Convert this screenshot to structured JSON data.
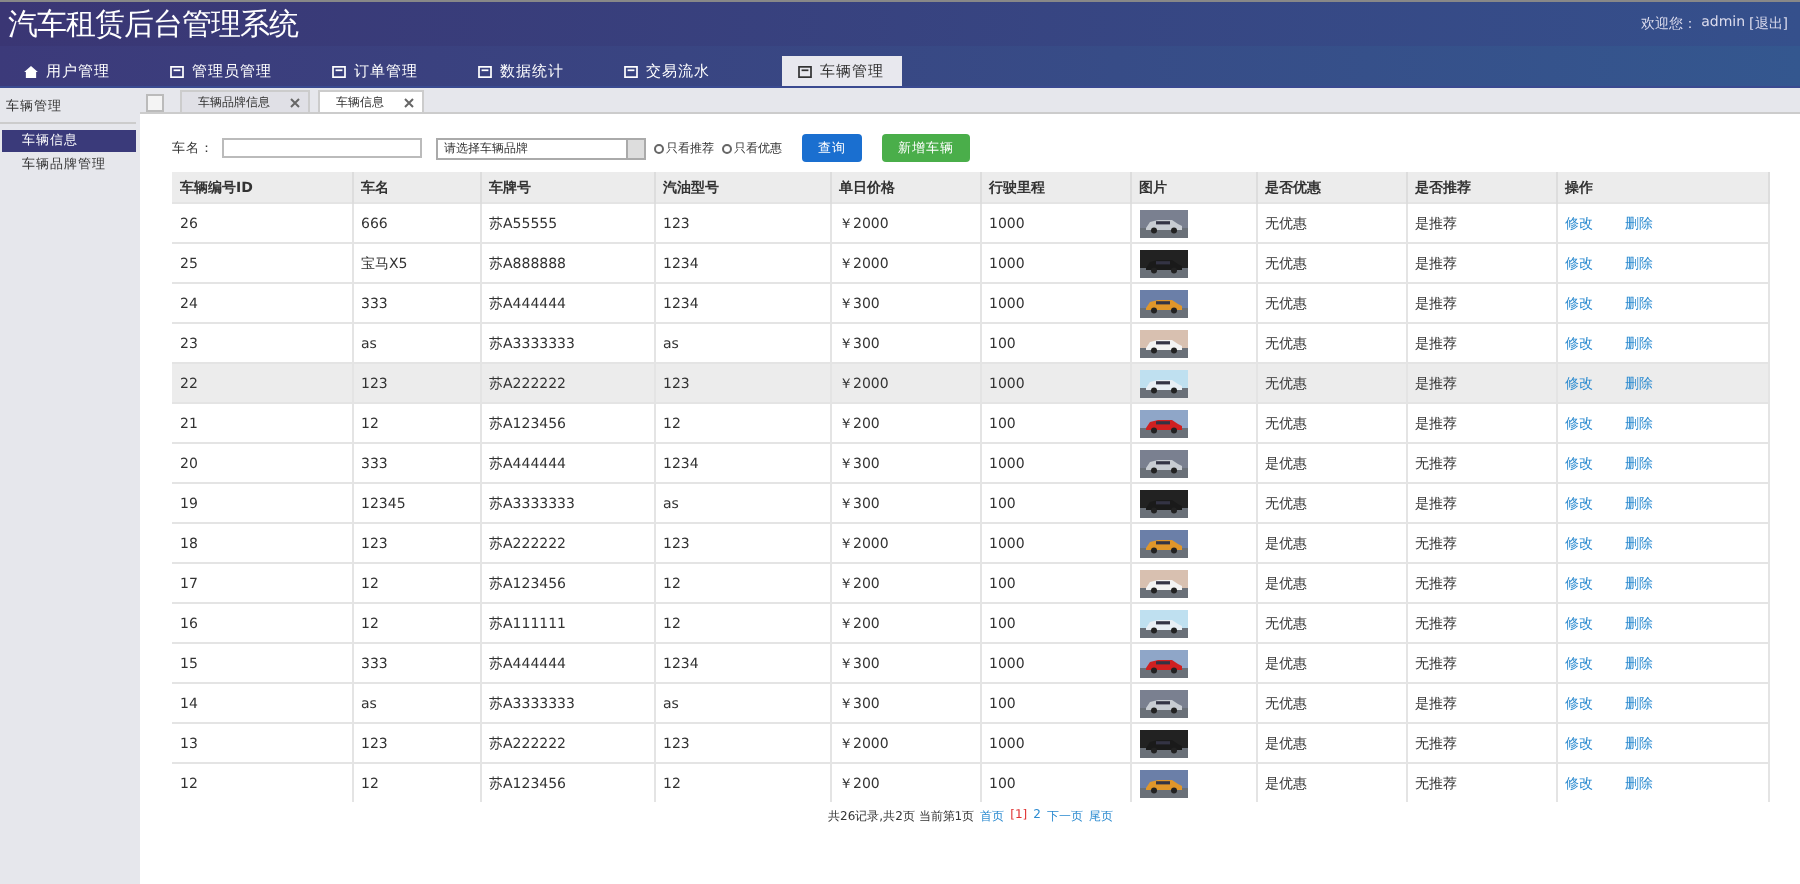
{
  "header": {
    "title": "汽车租赁后台管理系统",
    "welcome": "欢迎您：",
    "user": "admin",
    "logout": "[退出]"
  },
  "nav": [
    {
      "label": "用户管理",
      "selected": false
    },
    {
      "label": "管理员管理",
      "selected": false
    },
    {
      "label": "订单管理",
      "selected": false
    },
    {
      "label": "数据统计",
      "selected": false
    },
    {
      "label": "交易流水",
      "selected": false
    },
    {
      "label": "车辆管理",
      "selected": true
    }
  ],
  "sidebar": {
    "heading": "车辆管理",
    "items": [
      {
        "label": "车辆信息",
        "selected": true
      },
      {
        "label": "车辆品牌管理",
        "selected": false
      }
    ]
  },
  "tabs": [
    {
      "label": "车辆品牌信息",
      "selected": false
    },
    {
      "label": "车辆信息",
      "selected": true
    }
  ],
  "search": {
    "label": "车名：",
    "brand_select": "请选择车辆品牌",
    "radios": [
      {
        "label": "只看推荐",
        "checked": false
      },
      {
        "label": "只看优惠",
        "checked": false
      }
    ],
    "query_button": "查询",
    "add_button": "新增车辆"
  },
  "table": {
    "columns": [
      "车辆编号ID",
      "车名",
      "车牌号",
      "汽油型号",
      "单日价格",
      "行驶里程",
      "图片",
      "是否优惠",
      "是否推荐",
      "操作"
    ],
    "rows": [
      {
        "id": "26",
        "name": "666",
        "plate": "苏A55555",
        "fuel": "123",
        "price": "￥2000",
        "mileage": "1000",
        "discount": "无优惠",
        "recommend": "是推荐",
        "edit": "修改",
        "delete": "删除",
        "highlighted": false
      },
      {
        "id": "25",
        "name": "宝马X5",
        "plate": "苏A888888",
        "fuel": "1234",
        "price": "￥2000",
        "mileage": "1000",
        "discount": "无优惠",
        "recommend": "是推荐",
        "edit": "修改",
        "delete": "删除",
        "highlighted": false
      },
      {
        "id": "24",
        "name": "333",
        "plate": "苏A444444",
        "fuel": "1234",
        "price": "￥300",
        "mileage": "1000",
        "discount": "无优惠",
        "recommend": "是推荐",
        "edit": "修改",
        "delete": "删除",
        "highlighted": false
      },
      {
        "id": "23",
        "name": "as",
        "plate": "苏A3333333",
        "fuel": "as",
        "price": "￥300",
        "mileage": "100",
        "discount": "无优惠",
        "recommend": "是推荐",
        "edit": "修改",
        "delete": "删除",
        "highlighted": false
      },
      {
        "id": "22",
        "name": "123",
        "plate": "苏A222222",
        "fuel": "123",
        "price": "￥2000",
        "mileage": "1000",
        "discount": "无优惠",
        "recommend": "是推荐",
        "edit": "修改",
        "delete": "删除",
        "highlighted": true
      },
      {
        "id": "21",
        "name": "12",
        "plate": "苏A123456",
        "fuel": "12",
        "price": "￥200",
        "mileage": "100",
        "discount": "无优惠",
        "recommend": "是推荐",
        "edit": "修改",
        "delete": "删除",
        "highlighted": false
      },
      {
        "id": "20",
        "name": "333",
        "plate": "苏A444444",
        "fuel": "1234",
        "price": "￥300",
        "mileage": "1000",
        "discount": "是优惠",
        "recommend": "无推荐",
        "edit": "修改",
        "delete": "删除",
        "highlighted": false
      },
      {
        "id": "19",
        "name": "12345",
        "plate": "苏A3333333",
        "fuel": "as",
        "price": "￥300",
        "mileage": "100",
        "discount": "无优惠",
        "recommend": "是推荐",
        "edit": "修改",
        "delete": "删除",
        "highlighted": false
      },
      {
        "id": "18",
        "name": "123",
        "plate": "苏A222222",
        "fuel": "123",
        "price": "￥2000",
        "mileage": "1000",
        "discount": "是优惠",
        "recommend": "无推荐",
        "edit": "修改",
        "delete": "删除",
        "highlighted": false
      },
      {
        "id": "17",
        "name": "12",
        "plate": "苏A123456",
        "fuel": "12",
        "price": "￥200",
        "mileage": "100",
        "discount": "是优惠",
        "recommend": "无推荐",
        "edit": "修改",
        "delete": "删除",
        "highlighted": false
      },
      {
        "id": "16",
        "name": "12",
        "plate": "苏A111111",
        "fuel": "12",
        "price": "￥200",
        "mileage": "100",
        "discount": "无优惠",
        "recommend": "无推荐",
        "edit": "修改",
        "delete": "删除",
        "highlighted": false
      },
      {
        "id": "15",
        "name": "333",
        "plate": "苏A444444",
        "fuel": "1234",
        "price": "￥300",
        "mileage": "1000",
        "discount": "是优惠",
        "recommend": "无推荐",
        "edit": "修改",
        "delete": "删除",
        "highlighted": false
      },
      {
        "id": "14",
        "name": "as",
        "plate": "苏A3333333",
        "fuel": "as",
        "price": "￥300",
        "mileage": "100",
        "discount": "无优惠",
        "recommend": "是推荐",
        "edit": "修改",
        "delete": "删除",
        "highlighted": false
      },
      {
        "id": "13",
        "name": "123",
        "plate": "苏A222222",
        "fuel": "123",
        "price": "￥2000",
        "mileage": "1000",
        "discount": "是优惠",
        "recommend": "无推荐",
        "edit": "修改",
        "delete": "删除",
        "highlighted": false
      },
      {
        "id": "12",
        "name": "12",
        "plate": "苏A123456",
        "fuel": "12",
        "price": "￥200",
        "mileage": "100",
        "discount": "是优惠",
        "recommend": "无推荐",
        "edit": "修改",
        "delete": "删除",
        "highlighted": false
      }
    ]
  },
  "pagination": {
    "summary": "共26记录,共2页 当前第1页",
    "links": [
      {
        "label": "首页",
        "selected": false
      },
      {
        "label": "[1]",
        "selected": true
      },
      {
        "label": "2",
        "selected": false
      },
      {
        "label": "下一页",
        "selected": false
      },
      {
        "label": "尾页",
        "selected": false
      }
    ]
  }
}
